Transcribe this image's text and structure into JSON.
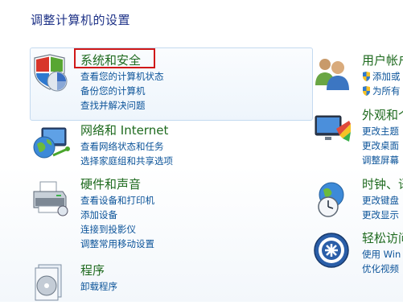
{
  "page": {
    "title": "调整计算机的设置"
  },
  "left": [
    {
      "key": "system",
      "title": "系统和安全",
      "icon": "shield-icon",
      "links": [
        "查看您的计算机状态",
        "备份您的计算机",
        "查找并解决问题"
      ]
    },
    {
      "key": "network",
      "title": "网络和 Internet",
      "icon": "network-globe-icon",
      "links": [
        "查看网络状态和任务",
        "选择家庭组和共享选项"
      ]
    },
    {
      "key": "hardware",
      "title": "硬件和声音",
      "icon": "printer-icon",
      "links": [
        "查看设备和打印机",
        "添加设备",
        "连接到投影仪",
        "调整常用移动设置"
      ]
    },
    {
      "key": "programs",
      "title": "程序",
      "icon": "programs-disc-icon",
      "links": [
        "卸载程序"
      ]
    }
  ],
  "right": [
    {
      "key": "user",
      "title": "用户帐户",
      "icon": "users-icon",
      "links": [
        "添加或",
        "为所有"
      ]
    },
    {
      "key": "appearance",
      "title": "外观和个",
      "icon": "appearance-monitor-icon",
      "links": [
        "更改主题",
        "更改桌面",
        "调整屏幕"
      ]
    },
    {
      "key": "clock",
      "title": "时钟、语",
      "icon": "clock-globe-icon",
      "links": [
        "更改键盘",
        "更改显示"
      ]
    },
    {
      "key": "ease",
      "title": "轻松访问",
      "icon": "ease-of-access-icon",
      "links": [
        "使用 Win",
        "优化视频"
      ]
    }
  ]
}
